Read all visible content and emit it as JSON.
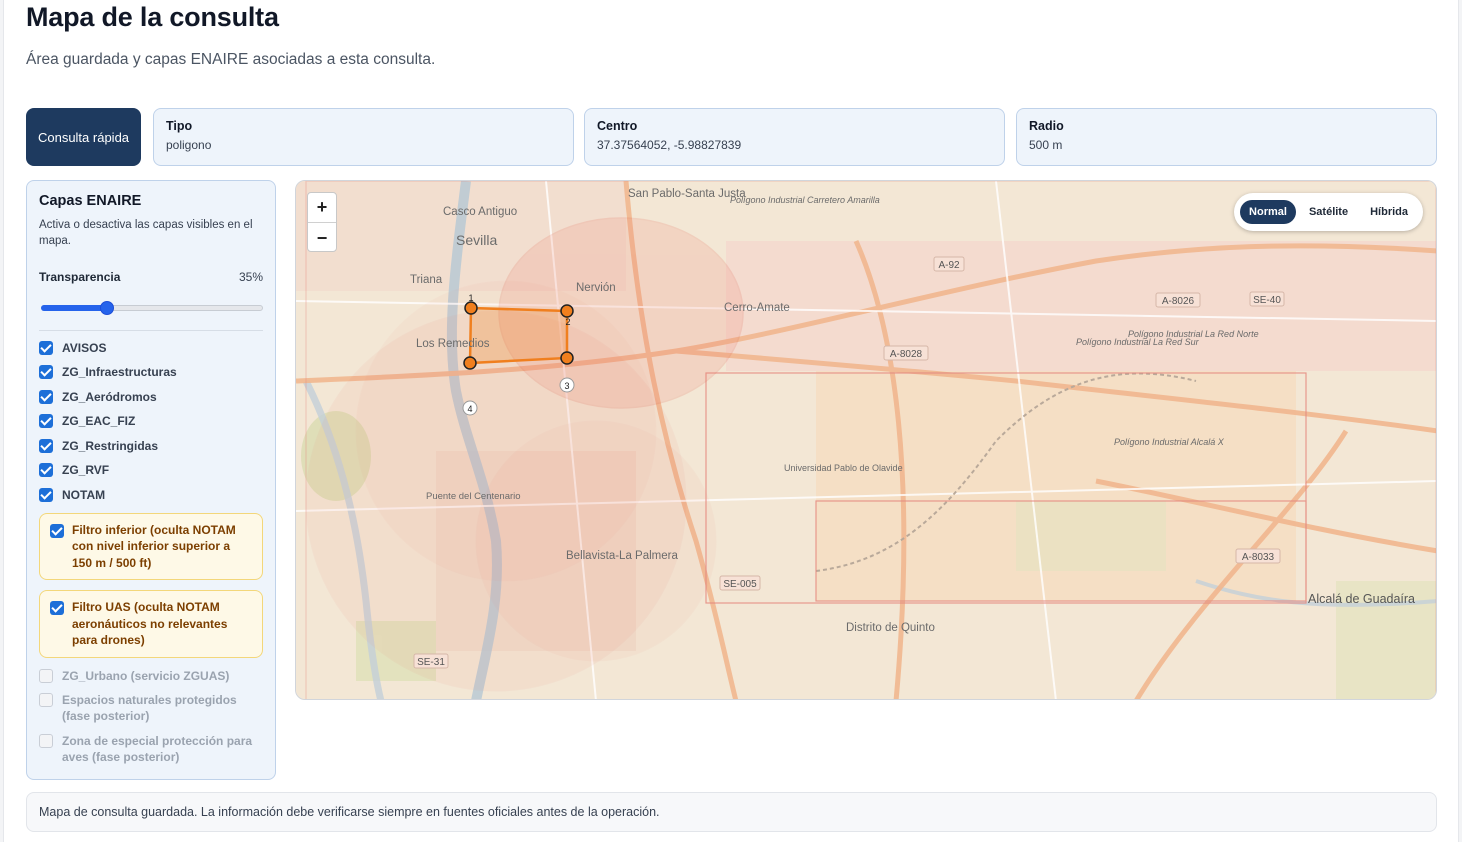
{
  "page": {
    "title": "Mapa de la consulta",
    "subtitle": "Área guardada y capas ENAIRE asociadas a esta consulta."
  },
  "summary": {
    "quick_button": "Consulta rápida",
    "cards": [
      {
        "label": "Tipo",
        "value": "poligono"
      },
      {
        "label": "Centro",
        "value": "37.37564052, -5.98827839"
      },
      {
        "label": "Radio",
        "value": "500 m"
      }
    ]
  },
  "sidebar": {
    "title": "Capas ENAIRE",
    "description": "Activa o desactiva las capas visibles en el mapa.",
    "transparency_label": "Transparencia",
    "transparency_value": "35%",
    "transparency_fraction": 0.3,
    "layers": [
      {
        "label": "AVISOS",
        "checked": true
      },
      {
        "label": "ZG_Infraestructuras",
        "checked": true
      },
      {
        "label": "ZG_Aeródromos",
        "checked": true
      },
      {
        "label": "ZG_EAC_FIZ",
        "checked": true
      },
      {
        "label": "ZG_Restringidas",
        "checked": true
      },
      {
        "label": "ZG_RVF",
        "checked": true
      },
      {
        "label": "NOTAM",
        "checked": true
      }
    ],
    "filters": [
      {
        "label": "Filtro inferior (oculta NOTAM con nivel inferior superior a 150 m / 500 ft)",
        "checked": true
      },
      {
        "label": "Filtro UAS (oculta NOTAM aeronáuticos no relevantes para drones)",
        "checked": true
      }
    ],
    "disabled_layers": [
      {
        "label": "ZG_Urbano (servicio ZGUAS)",
        "checked": false
      },
      {
        "label": "Espacios naturales protegidos (fase posterior)",
        "checked": false
      },
      {
        "label": "Zona de especial protección para aves (fase posterior)",
        "checked": false
      }
    ]
  },
  "map": {
    "zoom_in": "+",
    "zoom_out": "−",
    "basemap_options": [
      "Normal",
      "Satélite",
      "Híbrida"
    ],
    "basemap_selected": "Normal",
    "vertex_labels": [
      "1",
      "2",
      "3",
      "4"
    ],
    "place_labels": [
      "Casco Antiguo",
      "Sevilla",
      "Triana",
      "Los Remedios",
      "Nervión",
      "San Pablo-Santa Justa",
      "Cerro-Amate",
      "Bellavista-La Palmera",
      "Distrito de Quinto",
      "Alcalá de Guadaíra",
      "Universidad Pablo de Olavide",
      "Puente del Centenario",
      "Polígono Industrial La Red Sur",
      "Polígono Industrial La Red Norte",
      "Polígono Industrial Alcalá X",
      "Polígono Industrial Carretero Amarilla"
    ],
    "road_labels": [
      "A-92",
      "A-8026",
      "SE-40",
      "A-8028",
      "A-8033",
      "SE-005",
      "SE-31"
    ],
    "colors": {
      "polygon": "#f07f1e",
      "zone": "#e74c3c",
      "land": "#f2e8d7"
    }
  },
  "footer": {
    "note": "Mapa de consulta guardada. La información debe verificarse siempre en fuentes oficiales antes de la operación."
  }
}
